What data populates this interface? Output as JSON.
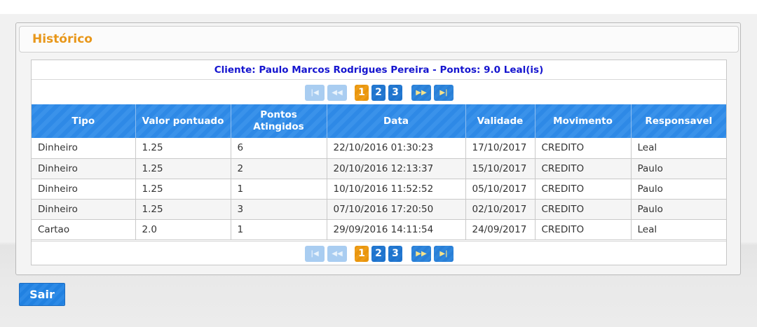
{
  "panel": {
    "title": "Histórico"
  },
  "grid": {
    "caption": "Cliente: Paulo Marcos Rodrigues Pereira - Pontos: 9.0 Leal(is)",
    "paginator": {
      "first_icon": "first-page-icon",
      "prev_icon": "previous-page-icon",
      "next_icon": "next-page-icon",
      "last_icon": "last-page-icon",
      "pages": [
        "1",
        "2",
        "3"
      ],
      "current_page": "1"
    },
    "columns": [
      "Tipo",
      "Valor pontuado",
      "Pontos Atingidos",
      "Data",
      "Validade",
      "Movimento",
      "Responsavel"
    ],
    "rows": [
      [
        "Dinheiro",
        "1.25",
        "6",
        "22/10/2016 01:30:23",
        "17/10/2017",
        "CREDITO",
        "Leal"
      ],
      [
        "Dinheiro",
        "1.25",
        "2",
        "20/10/2016 12:13:37",
        "15/10/2017",
        "CREDITO",
        "Paulo"
      ],
      [
        "Dinheiro",
        "1.25",
        "1",
        "10/10/2016 11:52:52",
        "05/10/2017",
        "CREDITO",
        "Paulo"
      ],
      [
        "Dinheiro",
        "1.25",
        "3",
        "07/10/2016 17:20:50",
        "02/10/2017",
        "CREDITO",
        "Paulo"
      ],
      [
        "Cartao",
        "2.0",
        "1",
        "29/09/2016 14:11:54",
        "24/09/2017",
        "CREDITO",
        "Leal"
      ]
    ]
  },
  "actions": {
    "exit_label": "Sair"
  },
  "colors": {
    "title_accent": "#e8971a",
    "caption_text": "#1515cf",
    "header_blue": "#2e89e6",
    "active_page": "#e8950d",
    "page_button": "#1e73cc"
  }
}
